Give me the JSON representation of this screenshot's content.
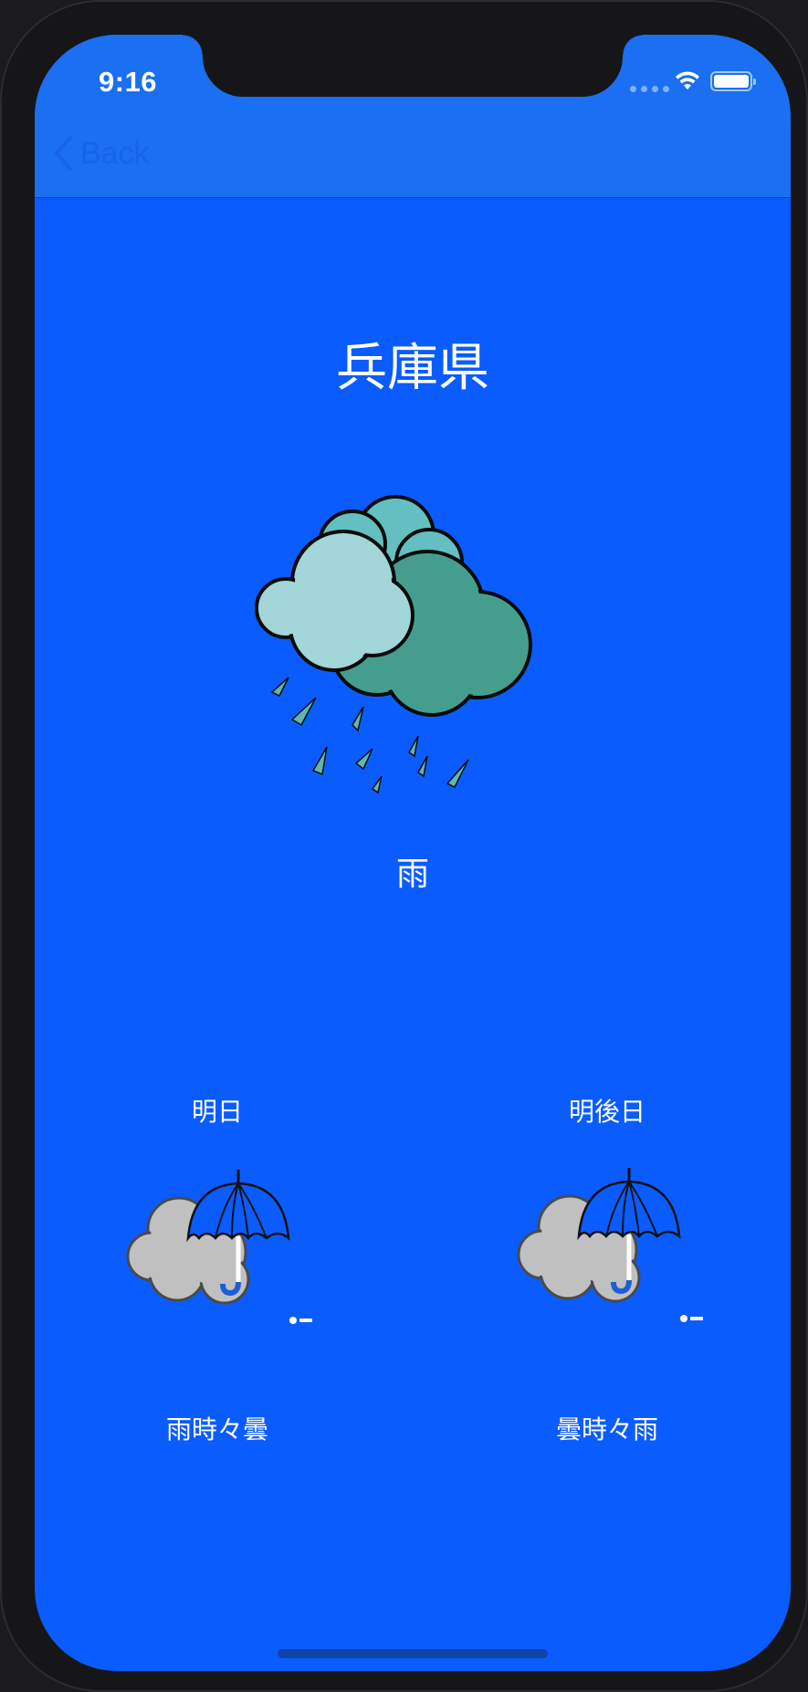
{
  "status_bar": {
    "time": "9:16"
  },
  "nav": {
    "back_label": "Back",
    "back_icon": "chevron-left-icon"
  },
  "main": {
    "prefecture": "兵庫県",
    "today_icon": "rain-cloud-icon",
    "today_weather": "雨"
  },
  "forecast": [
    {
      "day": "明日",
      "icon": "cloud-umbrella-icon",
      "weather": "雨時々曇"
    },
    {
      "day": "明後日",
      "icon": "cloud-umbrella-icon",
      "weather": "曇時々雨"
    }
  ],
  "colors": {
    "background": "#0a5cff",
    "navbar": "#1a6ff2",
    "back_tint": "#1763ea",
    "text": "#ffffff"
  }
}
